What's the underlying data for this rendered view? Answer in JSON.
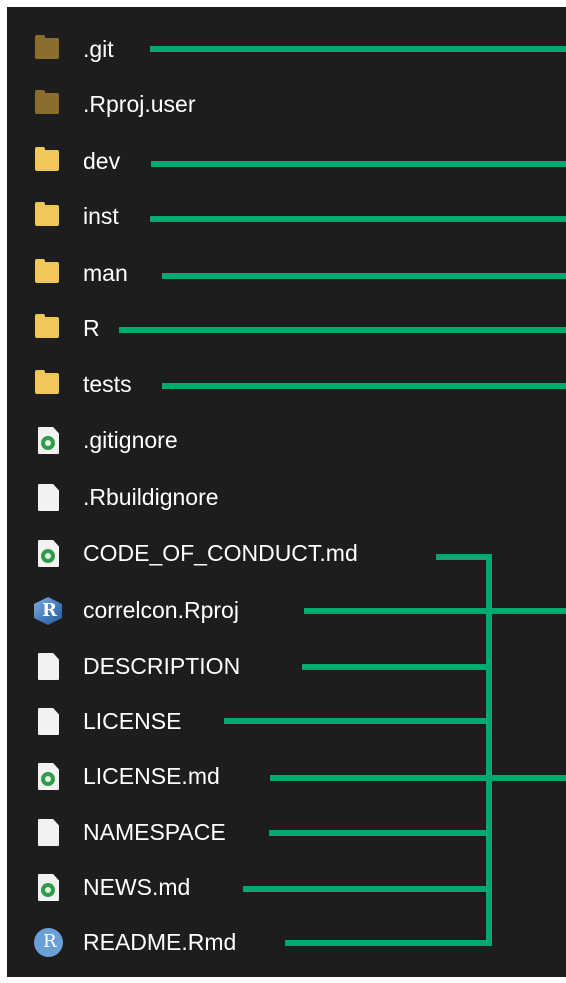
{
  "colors": {
    "background": "#1d1d1d",
    "text": "#ffffff",
    "connector": "#00a872",
    "folder": "#f0c85a",
    "folder_hidden": "#8a6d2d"
  },
  "items": [
    {
      "name": ".git",
      "icon": "folder-icon"
    },
    {
      "name": ".Rproj.user",
      "icon": "folder-icon"
    },
    {
      "name": "dev",
      "icon": "folder-icon"
    },
    {
      "name": "inst",
      "icon": "folder-icon"
    },
    {
      "name": "man",
      "icon": "folder-icon"
    },
    {
      "name": "R",
      "icon": "folder-icon"
    },
    {
      "name": "tests",
      "icon": "folder-icon"
    },
    {
      "name": ".gitignore",
      "icon": "markdown-file-icon"
    },
    {
      "name": ".Rbuildignore",
      "icon": "file-icon"
    },
    {
      "name": "CODE_OF_CONDUCT.md",
      "icon": "markdown-file-icon"
    },
    {
      "name": "correlcon.Rproj",
      "icon": "rproj-icon"
    },
    {
      "name": "DESCRIPTION",
      "icon": "file-icon"
    },
    {
      "name": "LICENSE",
      "icon": "file-icon"
    },
    {
      "name": "LICENSE.md",
      "icon": "markdown-file-icon"
    },
    {
      "name": "NAMESPACE",
      "icon": "file-icon"
    },
    {
      "name": "NEWS.md",
      "icon": "markdown-file-icon"
    },
    {
      "name": "README.Rmd",
      "icon": "r-icon"
    }
  ]
}
